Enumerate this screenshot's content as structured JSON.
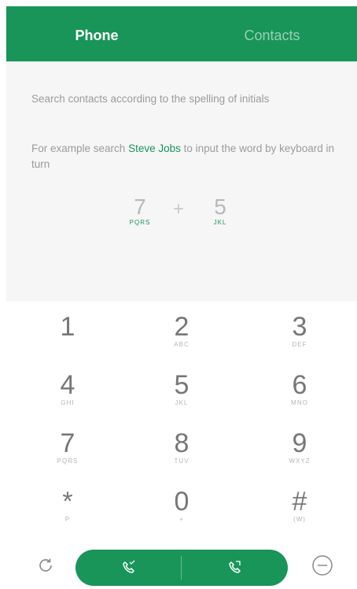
{
  "tabs": [
    {
      "label": "Phone",
      "active": true
    },
    {
      "label": "Contacts",
      "active": false
    }
  ],
  "hint": {
    "line1": "Search contacts according to the spelling of initials",
    "line2_pre": "For example search ",
    "line2_name": "Steve Jobs",
    "line2_post": " to input the word by keyboard in turn",
    "example": {
      "key1": {
        "digit": "7",
        "letters": "PQRS"
      },
      "plus": "+",
      "key2": {
        "digit": "5",
        "letters": "JKL"
      }
    }
  },
  "keypad": [
    {
      "digit": "1",
      "letters": ""
    },
    {
      "digit": "2",
      "letters": "ABC"
    },
    {
      "digit": "3",
      "letters": "DEF"
    },
    {
      "digit": "4",
      "letters": "GHI"
    },
    {
      "digit": "5",
      "letters": "JKL"
    },
    {
      "digit": "6",
      "letters": "MNO"
    },
    {
      "digit": "7",
      "letters": "PQRS"
    },
    {
      "digit": "8",
      "letters": "TUV"
    },
    {
      "digit": "9",
      "letters": "WXYZ"
    },
    {
      "digit": "*",
      "letters": "P"
    },
    {
      "digit": "0",
      "letters": "+"
    },
    {
      "digit": "#",
      "letters": "(W)"
    }
  ],
  "icons": {
    "left": "refresh-icon",
    "call1": "phone-call-icon",
    "call2": "phone-call-icon",
    "right": "minus-circle-icon"
  },
  "colors": {
    "accent": "#19955a",
    "tab_inactive": "rgba(255,255,255,0.55)",
    "hint_bg": "#f6f6f6"
  }
}
